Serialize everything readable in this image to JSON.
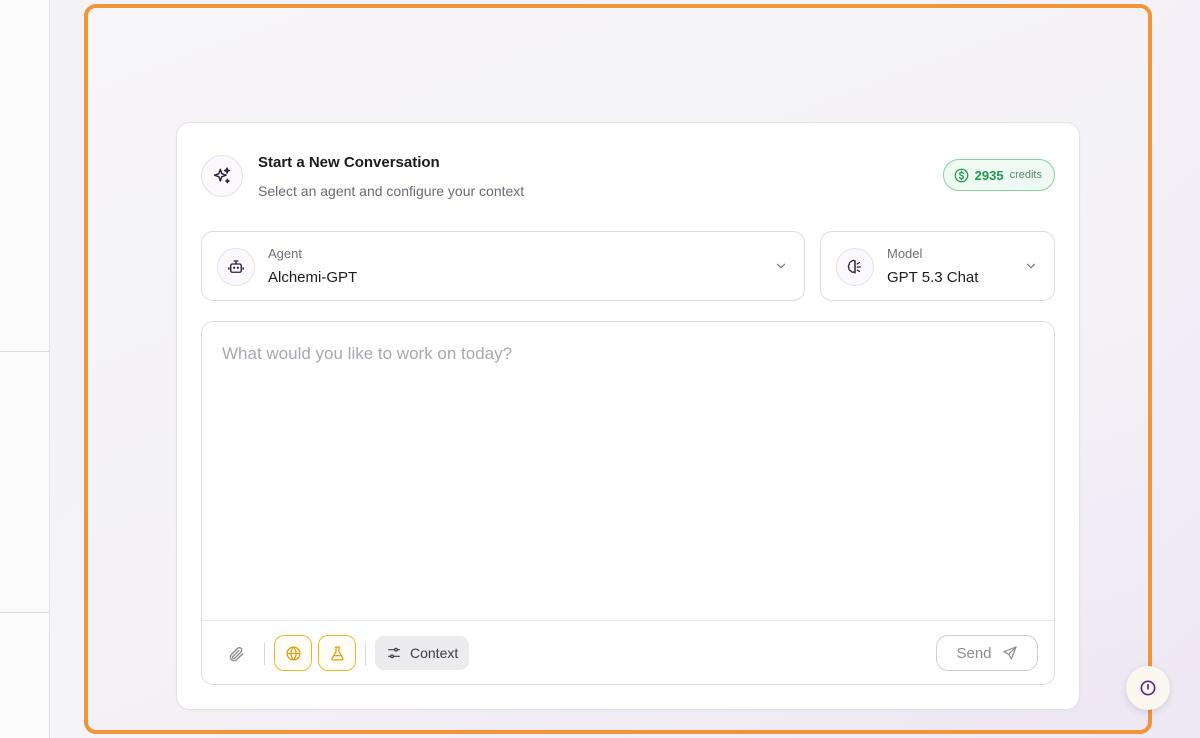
{
  "header": {
    "title": "Start a New Conversation",
    "subtitle": "Select an agent and configure your context",
    "icon": "sparkles-icon"
  },
  "credits": {
    "amount": "2935",
    "label": "credits",
    "icon": "dollar-circle-icon",
    "color": "#1f9a4d"
  },
  "agent": {
    "label": "Agent",
    "value": "Alchemi-GPT",
    "icon": "robot-icon"
  },
  "model": {
    "label": "Model",
    "value": "GPT 5.3 Chat",
    "icon": "brain-icon"
  },
  "composer": {
    "placeholder": "What would you like to work on today?",
    "value": ""
  },
  "toolbar": {
    "attach_icon": "paperclip-icon",
    "web_icon": "globe-icon",
    "lab_icon": "flask-icon",
    "context_label": "Context",
    "context_icon": "sliders-icon",
    "send_label": "Send",
    "send_icon": "send-icon"
  },
  "colors": {
    "accent_highlight": "#f2943a",
    "tool_active": "#f3b62a",
    "brand_purple": "#5b2a86"
  }
}
